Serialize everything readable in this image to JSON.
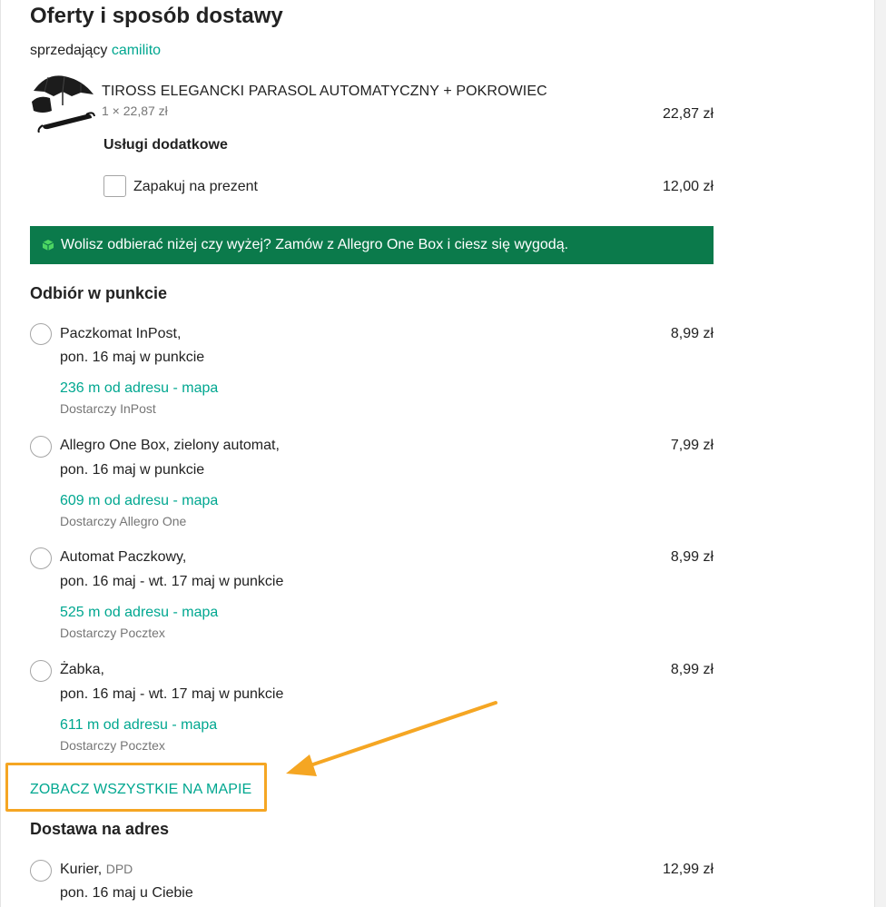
{
  "header": {
    "title": "Oferty i sposób dostawy",
    "seller_prefix": "sprzedający",
    "seller_name": "camilito"
  },
  "product": {
    "name": "TIROSS ELEGANCKI PARASOL AUTOMATYCZNY + POKROWIEC",
    "qty": "1 × 22,87 zł",
    "price": "22,87 zł"
  },
  "extras": {
    "title": "Usługi dodatkowe",
    "gift_label": "Zapakuj na prezent",
    "gift_price": "12,00 zł"
  },
  "banner": {
    "text": "Wolisz odbierać niżej czy wyżej? Zamów z Allegro One Box i ciesz się wygodą.",
    "icon": "box-icon",
    "color": "#0b7a4b"
  },
  "pickup": {
    "title": "Odbiór w punkcie",
    "options": [
      {
        "name": "Paczkomat InPost,",
        "date": "pon. 16 maj w punkcie",
        "distance": "236 m od adresu - mapa",
        "by": "Dostarczy InPost",
        "price": "8,99 zł"
      },
      {
        "name": "Allegro One Box, zielony automat,",
        "date": "pon. 16 maj w punkcie",
        "distance": "609 m od adresu - mapa",
        "by": "Dostarczy Allegro One",
        "price": "7,99 zł"
      },
      {
        "name": "Automat Paczkowy,",
        "date": "pon. 16 maj - wt. 17 maj w punkcie",
        "distance": "525 m od adresu - mapa",
        "by": "Dostarczy Pocztex",
        "price": "8,99 zł"
      },
      {
        "name": "Żabka,",
        "date": "pon. 16 maj - wt. 17 maj w punkcie",
        "distance": "611 m od adresu - mapa",
        "by": "Dostarczy Pocztex",
        "price": "8,99 zł"
      }
    ],
    "map_link": "ZOBACZ WSZYSTKIE NA MAPIE"
  },
  "address": {
    "title": "Dostawa na adres",
    "options": [
      {
        "name": "Kurier,",
        "carrier": "DPD",
        "date": "pon. 16 maj u Ciebie",
        "price": "12,99 zł"
      }
    ]
  },
  "colors": {
    "accent": "#00a790",
    "annotation": "#f5a623"
  }
}
